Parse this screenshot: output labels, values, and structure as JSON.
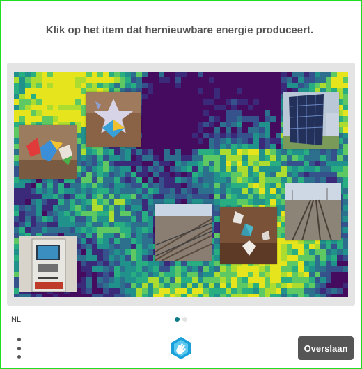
{
  "challenge": {
    "prompt": "Klik op het item dat hernieuwbare energie produceert."
  },
  "images": [
    {
      "name": "origami-star",
      "label": ""
    },
    {
      "name": "origami-toys",
      "label": ""
    },
    {
      "name": "solar-panel",
      "label": ""
    },
    {
      "name": "railway-tracks",
      "label": ""
    },
    {
      "name": "atm-machine",
      "label": ""
    },
    {
      "name": "railway-tracks-2",
      "label": ""
    },
    {
      "name": "origami-stars-2",
      "label": ""
    }
  ],
  "footer": {
    "language": "NL",
    "skip_label": "Overslaan",
    "page_indicator": {
      "current": 1,
      "total": 2
    }
  },
  "icons": {
    "menu": "more-vertical-icon",
    "logo": "hand-logo-icon"
  },
  "colors": {
    "frame_border": "#22dd22",
    "skip_button": "#555555",
    "active_dot": "#0b7c86",
    "logo": "#1aa0d8"
  }
}
